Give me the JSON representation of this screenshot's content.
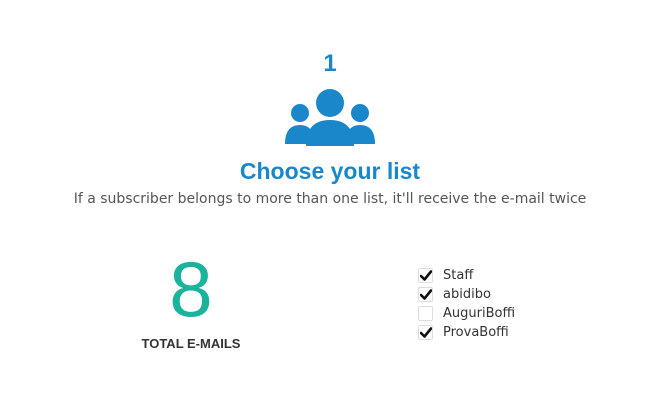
{
  "step": {
    "number": "1",
    "icon": "group-users-icon",
    "title": "Choose your list",
    "subtitle": "If a subscriber belongs to more than one list, it'll receive the e-mail twice"
  },
  "totals": {
    "count": "8",
    "label": "TOTAL E-MAILS"
  },
  "lists": [
    {
      "label": "Staff",
      "checked": true
    },
    {
      "label": "abidibo",
      "checked": true
    },
    {
      "label": "AuguriBoffi",
      "checked": false
    },
    {
      "label": "ProvaBoffi",
      "checked": true
    }
  ],
  "colors": {
    "accent": "#1b87cb",
    "count": "#1ab39b",
    "text": "#333333",
    "muted": "#555555"
  }
}
